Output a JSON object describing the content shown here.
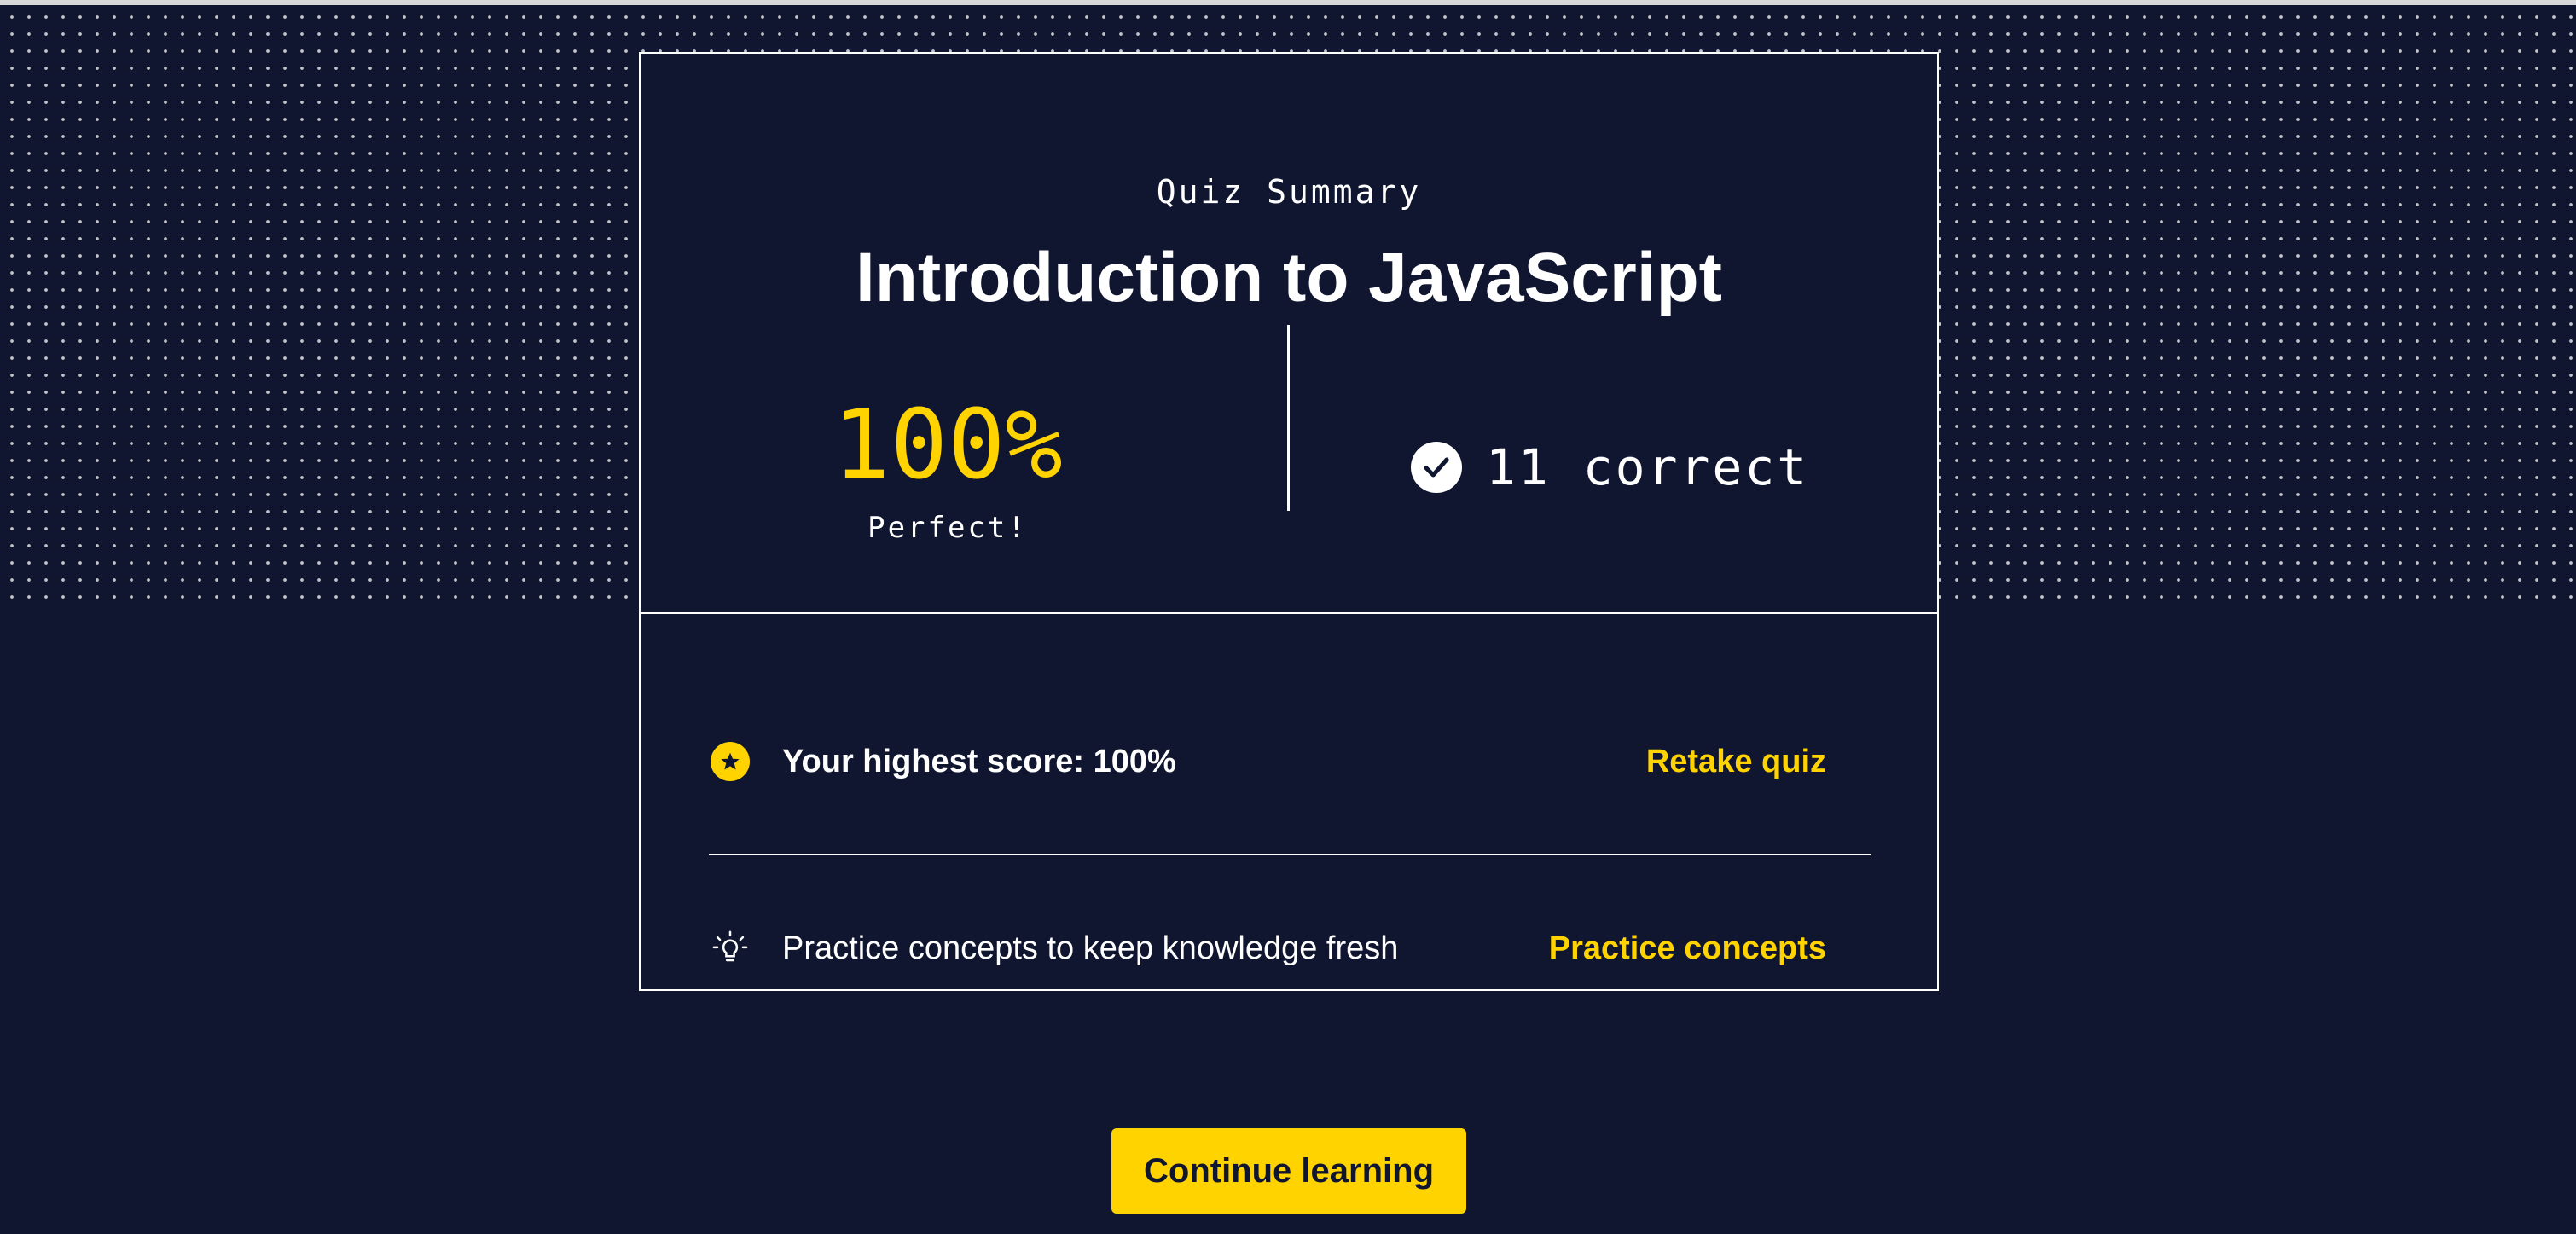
{
  "summary": {
    "eyebrow": "Quiz Summary",
    "title": "Introduction to JavaScript",
    "score_percent": "100%",
    "score_label": "Perfect!",
    "correct_text": "11 correct",
    "check_icon": "check-circle-icon"
  },
  "details": {
    "highest_score_text": "Your highest score: 100%",
    "highest_score_icon": "star-icon",
    "retake_label": "Retake quiz",
    "practice_text": "Practice concepts to keep knowledge fresh",
    "practice_icon": "lightbulb-icon",
    "practice_label": "Practice concepts"
  },
  "footer": {
    "continue_label": "Continue learning"
  },
  "colors": {
    "background": "#10162f",
    "accent": "#ffd300",
    "text": "#ffffff"
  }
}
